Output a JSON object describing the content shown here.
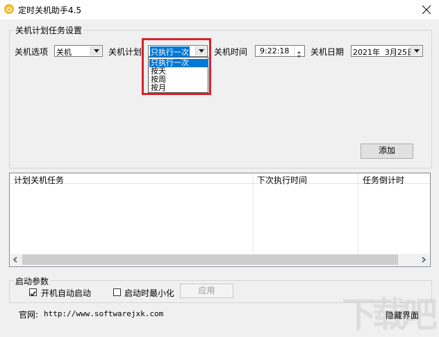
{
  "window": {
    "title": "定时关机助手4.5"
  },
  "settings_group": {
    "label": "关机计划任务设置",
    "option_label": "关机选项",
    "option_value": "关机",
    "plan_label": "关机计划",
    "plan_value": "只执行一次",
    "time_label": "关机时间",
    "time_value": "9:22:18",
    "date_label": "关机日期",
    "date_value": "2021年  3月25日",
    "plan_options": [
      "只执行一次",
      "按天",
      "按周",
      "按月"
    ],
    "add_button": "添加"
  },
  "task_list": {
    "columns": [
      "计划关机任务",
      "下次执行时间",
      "任务倒计时"
    ],
    "rows": []
  },
  "startup_group": {
    "label": "启动参数",
    "autostart_label": "开机自动启动",
    "autostart_checked": true,
    "minimize_label": "启动时最小化",
    "minimize_checked": false,
    "apply_button": "应用"
  },
  "footer": {
    "website_label": "官网:",
    "website_url": "http://www.softwarejxk.com",
    "hide_button": "隐藏界面"
  },
  "highlight_color": "#d9202a",
  "watermark": "下载吧"
}
